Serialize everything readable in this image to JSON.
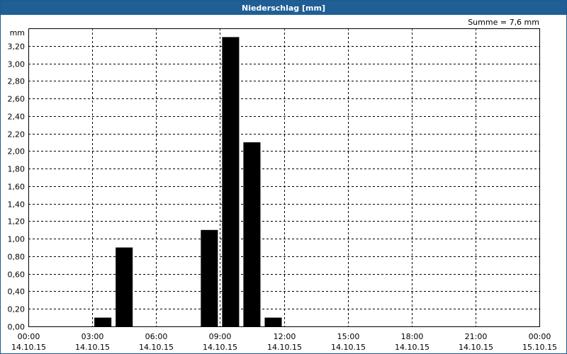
{
  "window": {
    "title": "Niederschlag [mm]"
  },
  "chart_data": {
    "type": "bar",
    "title": "Niederschlag [mm]",
    "y_unit": "mm",
    "summary": "Summe = 7,6 mm",
    "ylim": [
      0,
      3.4
    ],
    "y_ticks": [
      "0,00",
      "0,20",
      "0,40",
      "0,60",
      "0,80",
      "1,00",
      "1,20",
      "1,40",
      "1,60",
      "1,80",
      "2,00",
      "2,20",
      "2,40",
      "2,60",
      "2,80",
      "3,00",
      "3,20"
    ],
    "xlim_hours": [
      0,
      24
    ],
    "x_ticks": [
      {
        "time": "00:00",
        "date": "14.10.15"
      },
      {
        "time": "03:00",
        "date": "14.10.15"
      },
      {
        "time": "06:00",
        "date": "14.10.15"
      },
      {
        "time": "09:00",
        "date": "14.10.15"
      },
      {
        "time": "12:00",
        "date": "14.10.15"
      },
      {
        "time": "15:00",
        "date": "14.10.15"
      },
      {
        "time": "18:00",
        "date": "14.10.15"
      },
      {
        "time": "21:00",
        "date": "14.10.15"
      },
      {
        "time": "00:00",
        "date": "15.10.15"
      }
    ],
    "bars": [
      {
        "time": "03:00",
        "value": 0.1
      },
      {
        "time": "04:00",
        "value": 0.9
      },
      {
        "time": "08:00",
        "value": 1.1
      },
      {
        "time": "09:00",
        "value": 3.3
      },
      {
        "time": "10:00",
        "value": 2.1
      },
      {
        "time": "11:00",
        "value": 0.1
      }
    ],
    "grid": true,
    "bar_color": "#000000"
  }
}
